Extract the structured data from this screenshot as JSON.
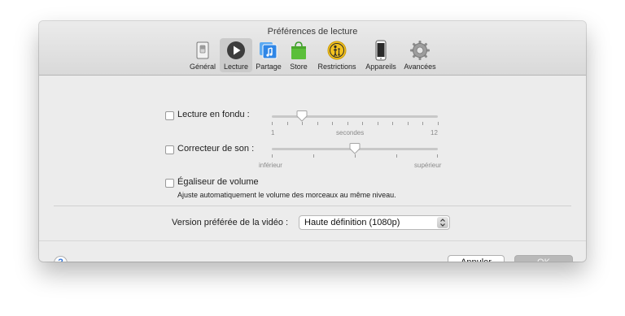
{
  "window": {
    "title": "Préférences de lecture"
  },
  "tabs": [
    {
      "label": "Général",
      "icon": "general-switch-icon"
    },
    {
      "label": "Lecture",
      "icon": "play-icon",
      "selected": true
    },
    {
      "label": "Partage",
      "icon": "music-share-icon"
    },
    {
      "label": "Store",
      "icon": "store-bag-icon"
    },
    {
      "label": "Restrictions",
      "icon": "parental-restriction-icon"
    },
    {
      "label": "Appareils",
      "icon": "iphone-device-icon"
    },
    {
      "label": "Avancées",
      "icon": "gear-icon"
    }
  ],
  "crossfade": {
    "label": "Lecture en fondu :",
    "checked": false,
    "min_label": "1",
    "mid_label": "secondes",
    "max_label": "12",
    "value": 3,
    "min": 1,
    "max": 12
  },
  "sound_check": {
    "label": "Correcteur de son :",
    "checked": false,
    "min_label": "inférieur",
    "max_label": "supérieur",
    "level": 0.5
  },
  "volume_eq": {
    "label": "Égaliseur de volume",
    "checked": false,
    "description": "Ajuste automatiquement le volume des morceaux au même niveau."
  },
  "video": {
    "label": "Version préférée de la vidéo :",
    "selected": "Haute définition (1080p)"
  },
  "footer": {
    "help_label": "?",
    "cancel_label": "Annuler",
    "ok_label": "OK"
  },
  "colors": {
    "accent": "#2e72d8",
    "selected_tab": "#cbcbcb"
  }
}
